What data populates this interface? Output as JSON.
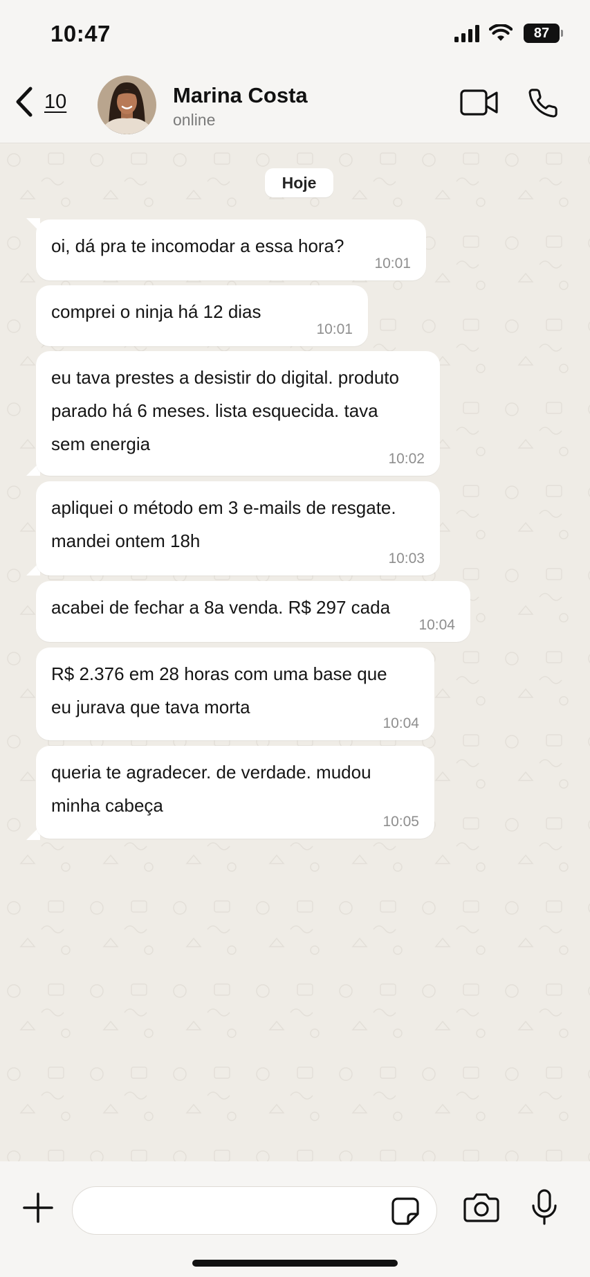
{
  "status_bar": {
    "time": "10:47",
    "battery": "87",
    "icons": [
      "signal-icon",
      "wifi-icon",
      "battery-icon"
    ]
  },
  "header": {
    "back_count": "10",
    "contact_name": "Marina Costa",
    "contact_status": "online",
    "icons": [
      "back-chevron-icon",
      "video-call-icon",
      "phone-icon"
    ]
  },
  "chat": {
    "date_label": "Hoje",
    "messages": [
      {
        "text": "oi, dá pra te incomodar a essa hora?",
        "time": "10:01"
      },
      {
        "text": "comprei o ninja há 12 dias",
        "time": "10:01"
      },
      {
        "text": "eu tava prestes a desistir do digital. produto\nparado há 6 meses. lista esquecida. tava\nsem energia",
        "time": "10:02"
      },
      {
        "text": "apliquei o método em 3 e-mails de resgate.\nmandei ontem 18h",
        "time": "10:03"
      },
      {
        "text": "acabei de fechar a 8a venda. R$ 297 cada",
        "time": "10:04"
      },
      {
        "text": "R$ 2.376 em 28 horas com uma base que\neu jurava que tava morta",
        "time": "10:04"
      },
      {
        "text": "queria te agradecer. de verdade. mudou\nminha cabeça",
        "time": "10:05"
      }
    ]
  },
  "composer": {
    "input_value": "",
    "icons": [
      "plus-icon",
      "sticker-icon",
      "camera-icon",
      "microphone-icon"
    ]
  },
  "colors": {
    "header_bg": "#f6f5f3",
    "chat_bg": "#efece6",
    "bubble_bg": "#ffffff",
    "time_text": "#8e8e8e"
  }
}
